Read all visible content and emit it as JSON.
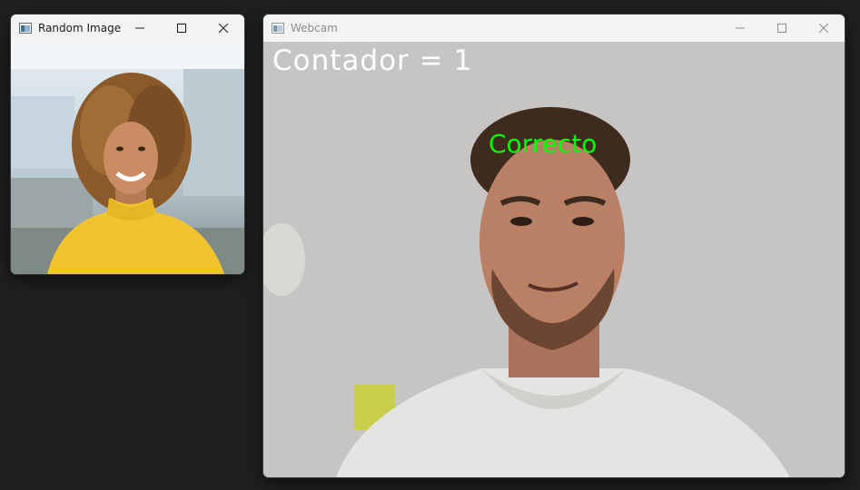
{
  "windows": {
    "random_image": {
      "title": "Random Image",
      "icon": "opencv-window-icon",
      "controls": [
        "minimize-icon",
        "maximize-icon",
        "close-icon"
      ],
      "active": true
    },
    "webcam": {
      "title": "Webcam",
      "icon": "opencv-window-icon",
      "controls": [
        "minimize-icon",
        "maximize-icon",
        "close-icon"
      ],
      "active": false,
      "overlay": {
        "counter_text": "Contador = 1",
        "counter_color": "#ffffff",
        "status_text": "Correcto",
        "status_color": "#00ff00"
      }
    }
  }
}
